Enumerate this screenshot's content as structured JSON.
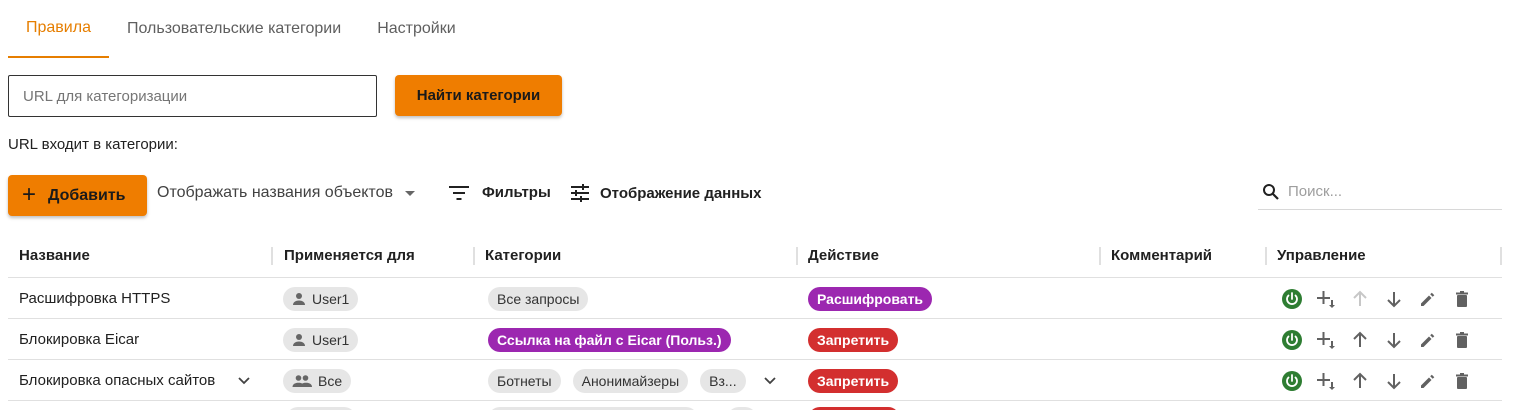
{
  "tabs": [
    "Правила",
    "Пользовательские категории",
    "Настройки"
  ],
  "url_search": {
    "placeholder": "URL для категоризации",
    "button_label": "Найти категории",
    "result_label": "URL входит в категории:"
  },
  "toolbar": {
    "add_label": "Добавить",
    "display_names_label": "Отображать названия объектов",
    "filters_label": "Фильтры",
    "data_display_label": "Отображение данных",
    "search_placeholder": "Поиск..."
  },
  "table": {
    "columns": [
      "Название",
      "Применяется для",
      "Категории",
      "Действие",
      "Комментарий",
      "Управление"
    ],
    "rows": [
      {
        "name": "Расшифровка HTTPS",
        "applies_to": "User1",
        "applies_icon": "person-icon",
        "categories": [
          "Все запросы"
        ],
        "action": "Расшифровать",
        "action_color": "#9c27b0",
        "comment": "",
        "up_disabled": true
      },
      {
        "name": "Блокировка Eicar",
        "applies_to": "User1",
        "applies_icon": "person-icon",
        "categories": [
          "Ссылка на файл с Eicar (Польз.)"
        ],
        "category_highlight": "#9c27b0",
        "action": "Запретить",
        "action_color": "#d32f2f",
        "comment": "",
        "up_disabled": false
      },
      {
        "name": "Блокировка опасных сайтов",
        "applies_to": "Все",
        "applies_icon": "group-icon",
        "categories": [
          "Ботнеты",
          "Анонимайзеры",
          "Вз..."
        ],
        "action": "Запретить",
        "action_color": "#d32f2f",
        "comment": "",
        "up_disabled": false
      }
    ]
  },
  "colors": {
    "accent": "#ef7d00",
    "enabled_icon": "#2e7d32"
  }
}
